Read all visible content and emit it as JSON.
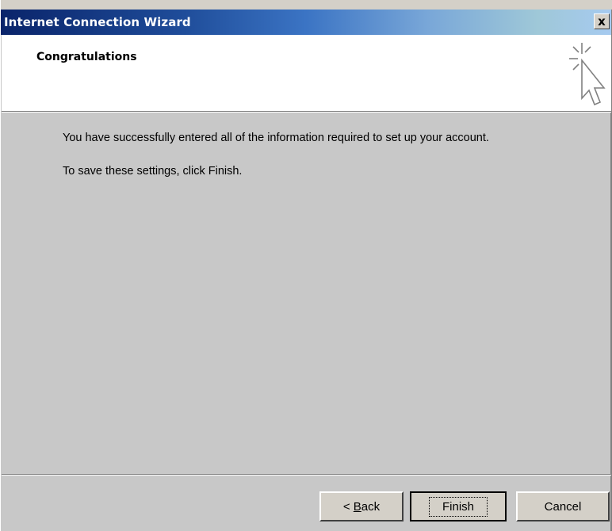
{
  "window": {
    "title": "Internet Connection Wizard",
    "close_label": "x"
  },
  "header": {
    "title": "Congratulations",
    "icon": "wizard-cursor-icon"
  },
  "body": {
    "line1": "You have successfully entered all of the information required to set up your account.",
    "line2": "To save these settings, click Finish."
  },
  "buttons": {
    "back_prefix": "< ",
    "back_mnemonic": "B",
    "back_rest": "ack",
    "finish": "Finish",
    "cancel": "Cancel"
  },
  "colors": {
    "title_start": "#0a246a",
    "title_end": "#a6caf0",
    "face": "#d4d0c8"
  }
}
